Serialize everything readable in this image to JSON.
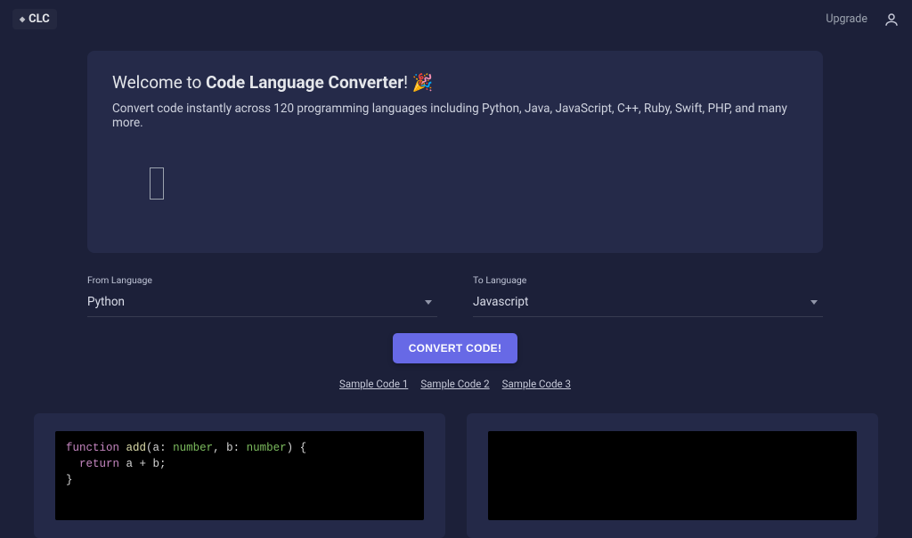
{
  "brand": {
    "label": "CLC"
  },
  "nav": {
    "upgrade": "Upgrade"
  },
  "hero": {
    "welcome_prefix": "Welcome to ",
    "title_strong": "Code Language Converter",
    "welcome_suffix": "! 🎉",
    "subtitle": "Convert code instantly across 120 programming languages including Python, Java, JavaScript, C++, Ruby, Swift, PHP, and many more."
  },
  "from": {
    "label": "From Language",
    "value": "Python"
  },
  "to": {
    "label": "To Language",
    "value": "Javascript"
  },
  "convert_label": "CONVERT CODE!",
  "samples": [
    "Sample Code 1",
    "Sample Code 2",
    "Sample Code 3"
  ],
  "code": {
    "kw_function": "function",
    "fn_name": " add",
    "open_paren": "(",
    "a": "a",
    "colon1": ": ",
    "t1": "number",
    "comma": ", ",
    "b": "b",
    "colon2": ": ",
    "t2": "number",
    "close_sig": ") {",
    "kw_return": "  return",
    "ret_expr": " a + b",
    "semi": ";",
    "close_brace": "}"
  }
}
